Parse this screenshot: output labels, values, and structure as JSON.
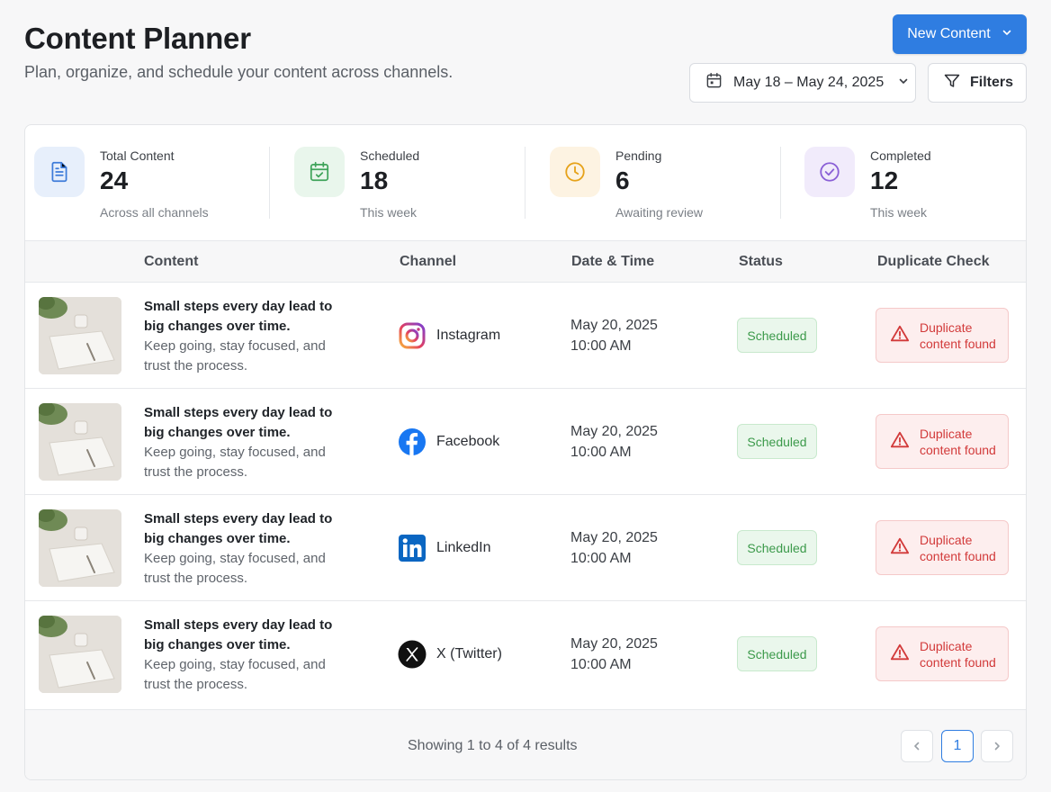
{
  "header": {
    "title": "Content Planner",
    "subtitle": "Plan, organize, and schedule your content across channels.",
    "new_button": "New Content",
    "date_range": "May 18 – May 24, 2025",
    "filters_button": "Filters"
  },
  "stats": [
    {
      "label": "Total Content",
      "value": "24",
      "note": "Across all channels",
      "icon": "document-icon",
      "color": "#3d7bd9"
    },
    {
      "label": "Scheduled",
      "value": "18",
      "note": "This week",
      "icon": "calendar-icon",
      "color": "#3fa35a"
    },
    {
      "label": "Pending",
      "value": "6",
      "note": "Awaiting review",
      "icon": "clock-icon",
      "color": "#e6a21a"
    },
    {
      "label": "Completed",
      "value": "12",
      "note": "This week",
      "icon": "check-circle-icon",
      "color": "#8a5fd6"
    }
  ],
  "table": {
    "headers": [
      "Content",
      "Channel",
      "Date & Time",
      "Status",
      "Duplicate Check"
    ],
    "rows": [
      {
        "title": "Small steps every day lead to big changes over time.",
        "body": "Keep going, stay focused, and trust the process.",
        "channel": "Instagram",
        "date": "May 20, 2025",
        "time": "10:00 AM",
        "status": "Scheduled",
        "dup1": "Duplicate",
        "dup2": "content found"
      },
      {
        "title": "Small steps every day lead to big changes over time.",
        "body": "Keep going, stay focused, and trust the process.",
        "channel": "Facebook",
        "date": "May 20, 2025",
        "time": "10:00 AM",
        "status": "Scheduled",
        "dup1": "Duplicate",
        "dup2": "content found"
      },
      {
        "title": "Small steps every day lead to big changes over time.",
        "body": "Keep going, stay focused, and trust the process.",
        "channel": "LinkedIn",
        "date": "May 20, 2025",
        "time": "10:00 AM",
        "status": "Scheduled",
        "dup1": "Duplicate",
        "dup2": "content found"
      },
      {
        "title": "Small steps every day lead to big changes over time.",
        "body": "Keep going, stay focused, and trust the process.",
        "channel": "X (Twitter)",
        "date": "May 20, 2025",
        "time": "10:00 AM",
        "status": "Scheduled",
        "dup1": "Duplicate",
        "dup2": "content found"
      }
    ]
  },
  "footer": {
    "results": "Showing 1 to 4 of 4 results",
    "current_page": "1"
  },
  "colors": {
    "accent": "#2f7de1",
    "success": "#3c9a4b",
    "danger": "#d23a3a"
  }
}
